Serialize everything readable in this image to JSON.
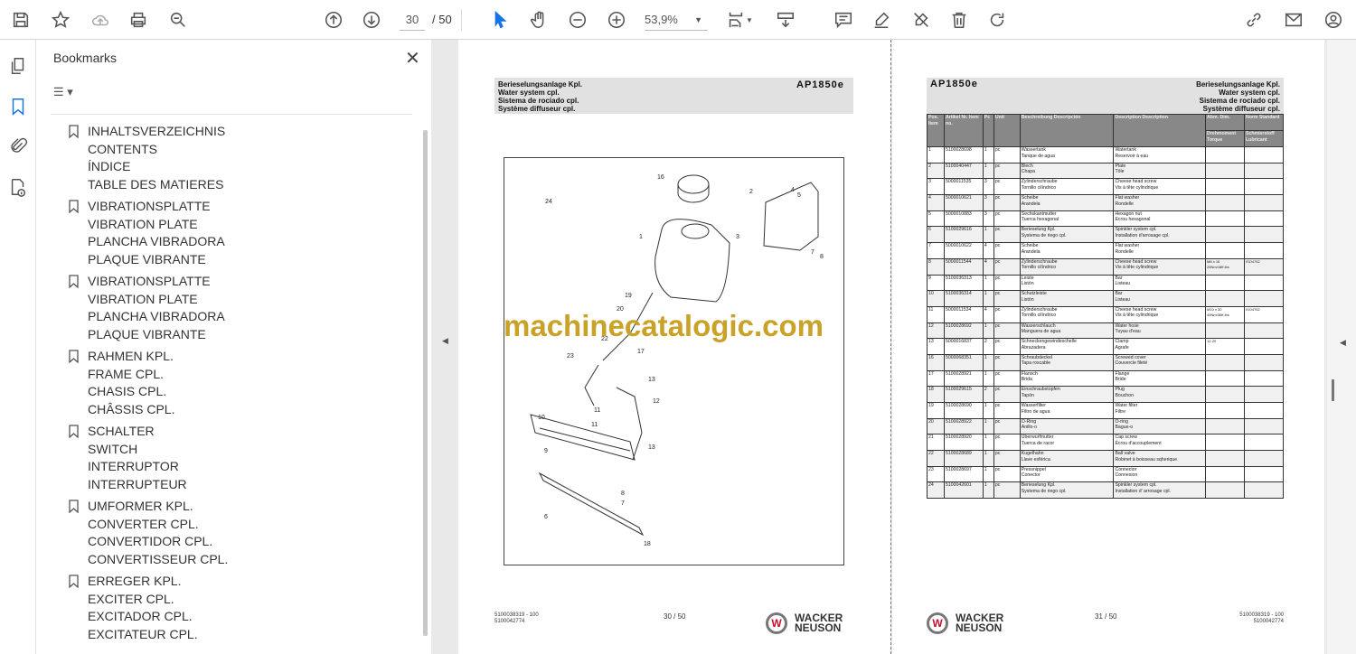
{
  "toolbar": {
    "page_current": "30",
    "page_total": "/ 50",
    "zoom": "53,9%"
  },
  "bookmarks": {
    "title": "Bookmarks",
    "groups": [
      [
        "INHALTSVERZEICHNIS",
        "CONTENTS",
        "ÍNDICE",
        "TABLE DES MATIERES"
      ],
      [
        "VIBRATIONSPLATTE",
        "VIBRATION PLATE",
        "PLANCHA VIBRADORA",
        "PLAQUE VIBRANTE"
      ],
      [
        "VIBRATIONSPLATTE",
        "VIBRATION PLATE",
        "PLANCHA VIBRADORA",
        "PLAQUE VIBRANTE"
      ],
      [
        "RAHMEN KPL.",
        "FRAME CPL.",
        "CHASIS CPL.",
        "CHÂSSIS CPL."
      ],
      [
        "SCHALTER",
        "SWITCH",
        "INTERRUPTOR",
        "INTERRUPTEUR"
      ],
      [
        "UMFORMER KPL.",
        "CONVERTER CPL.",
        "CONVERTIDOR CPL.",
        "CONVERTISSEUR CPL."
      ],
      [
        "ERREGER KPL.",
        "EXCITER CPL.",
        "EXCITADOR CPL.",
        "EXCITATEUR CPL."
      ]
    ]
  },
  "left_page": {
    "title_lines": [
      "Berieselungsanlage Kpl.",
      "Water system cpl.",
      "Sistema de rociado cpl.",
      "Système diffuseur cpl."
    ],
    "model": "AP1850e",
    "callouts": [
      "1",
      "2",
      "3",
      "4",
      "5",
      "6",
      "7",
      "8",
      "9",
      "10",
      "11",
      "11",
      "12",
      "13",
      "13",
      "16",
      "17",
      "18",
      "19",
      "20",
      "22",
      "23",
      "24",
      "8",
      "7"
    ],
    "footer_code1": "5100038319 - 100",
    "footer_code2": "5100042774",
    "page_label": "30 / 50",
    "brand_line1": "WACKER",
    "brand_line2": "NEUSON"
  },
  "watermark": "machinecatalogic.com",
  "right_page": {
    "model": "AP1850e",
    "title_lines": [
      "Berieselungsanlage Kpl.",
      "Water system cpl.",
      "Sistema de rociado cpl.",
      "Système diffuseur cpl."
    ],
    "headers": {
      "pos": "Pos. Item",
      "art": "Artikel Nr. Item no.",
      "pc": "Pc",
      "unit": "Unit",
      "besch": "Beschreibung Descripción",
      "desc": "Description Description",
      "dim": "Abm. Dim.",
      "torque": "Drehmoment Torque",
      "norm": "Norm Standard",
      "lub": "Schmierstoff Lubricant"
    },
    "rows": [
      [
        "1",
        "5100028698",
        "1",
        "pc",
        "Wassertank",
        "Tanque de agua",
        "Watertank",
        "Reservoir à eau",
        "",
        ""
      ],
      [
        "2",
        "5100040447",
        "1",
        "pc",
        "Blech",
        "Chapa",
        "Plate",
        "Tôle",
        "",
        ""
      ],
      [
        "3",
        "5000011535",
        "3",
        "pc",
        "Zylinderschraube",
        "Tornillo cilíndrico",
        "Cheese head screw",
        "Vis à tête cylindrique",
        "",
        ""
      ],
      [
        "4",
        "5000010621",
        "3",
        "pc",
        "Scheibe",
        "Arandela",
        "Flat washer",
        "Rondelle",
        "",
        ""
      ],
      [
        "5",
        "5000010883",
        "3",
        "pc",
        "Sechskantmutter",
        "Tuerca hexagonal",
        "Hexagon nut",
        "Ecrou hexagonal",
        "",
        ""
      ],
      [
        "6",
        "5100029616",
        "1",
        "pc",
        "Berieselung Kpl.",
        "Systema de riego cpl.",
        "Spinkler system cpl.",
        "Installation d'arrosage cpl.",
        "",
        ""
      ],
      [
        "7",
        "5000010622",
        "4",
        "pc",
        "Scheibe",
        "Arandela",
        "Flat washer",
        "Rondelle",
        "",
        ""
      ],
      [
        "8",
        "5000011544",
        "4",
        "pc",
        "Zylinderschraube",
        "Tornillo cilíndrico",
        "Cheese head screw",
        "Vis à tête cylindrique",
        "M8 x 16 25Nm/18ft.lbs",
        "ISO4762"
      ],
      [
        "9",
        "5100036313",
        "1",
        "pc",
        "Leiste",
        "Listón",
        "Bar",
        "Listeau",
        "",
        ""
      ],
      [
        "10",
        "5100036314",
        "1",
        "pc",
        "Schutzleiste",
        "Listón",
        "Bar",
        "Listeau",
        "",
        ""
      ],
      [
        "11",
        "5000011534",
        "4",
        "pc",
        "Zylinderschraube",
        "Tornillo cilíndrico",
        "Cheese head screw",
        "Vis à tête cylindrique",
        "M10 x 30 49Nm/36ft.lbs",
        "ISO4762"
      ],
      [
        "12",
        "5100028692",
        "1",
        "pc",
        "Wasserschlauch",
        "Manguera de agua",
        "Water hose",
        "Tuyau d'eau",
        "",
        ""
      ],
      [
        "13",
        "5000016837",
        "2",
        "pc",
        "Schneckengewindeschelle",
        "Abrazadera",
        "Clamp",
        "Agrafe",
        "12-20",
        ""
      ],
      [
        "16",
        "5000068351",
        "1",
        "pc",
        "Schraubdeckel",
        "Tapa roscable",
        "Screwed cover",
        "Couvercle fileté",
        "",
        ""
      ],
      [
        "17",
        "5100028921",
        "1",
        "pc",
        "Flansch",
        "Brida",
        "Flange",
        "Bride",
        "",
        ""
      ],
      [
        "18",
        "5100029615",
        "2",
        "pc",
        "Einschraubstopfen",
        "Tapón",
        "Plug",
        "Bouchon",
        "",
        ""
      ],
      [
        "19",
        "5100028690",
        "1",
        "pc",
        "Wasserfilter",
        "Filtro de agua",
        "Water filter",
        "Filtre",
        "",
        ""
      ],
      [
        "20",
        "5100028922",
        "1",
        "pc",
        "O-Ring",
        "Anillo-o",
        "O-ring",
        "Bague-o",
        "",
        ""
      ],
      [
        "21",
        "5100028920",
        "1",
        "pc",
        "Überwurfmutter",
        "Tuerca de racor",
        "Cap screw",
        "Écrou d'accouplement",
        "",
        ""
      ],
      [
        "22",
        "5100028689",
        "1",
        "pc",
        "Kugelhahn",
        "Llave esférica",
        "Ball valve",
        "Robinet à boisseau sqherique",
        "",
        ""
      ],
      [
        "23",
        "5100028697",
        "1",
        "pc",
        "Pressnippel",
        "Conector",
        "Connector",
        "Connexion",
        "",
        ""
      ],
      [
        "24",
        "5100042601",
        "1",
        "pc",
        "Berieselung Kpl.",
        "Systema de riego cpl.",
        "Spinkler system cpl.",
        "Installation d' arrosage cpl.",
        "",
        ""
      ]
    ],
    "page_label": "31 / 50",
    "footer_code1": "5100038319 - 100",
    "footer_code2": "5100042774",
    "brand_line1": "WACKER",
    "brand_line2": "NEUSON"
  }
}
